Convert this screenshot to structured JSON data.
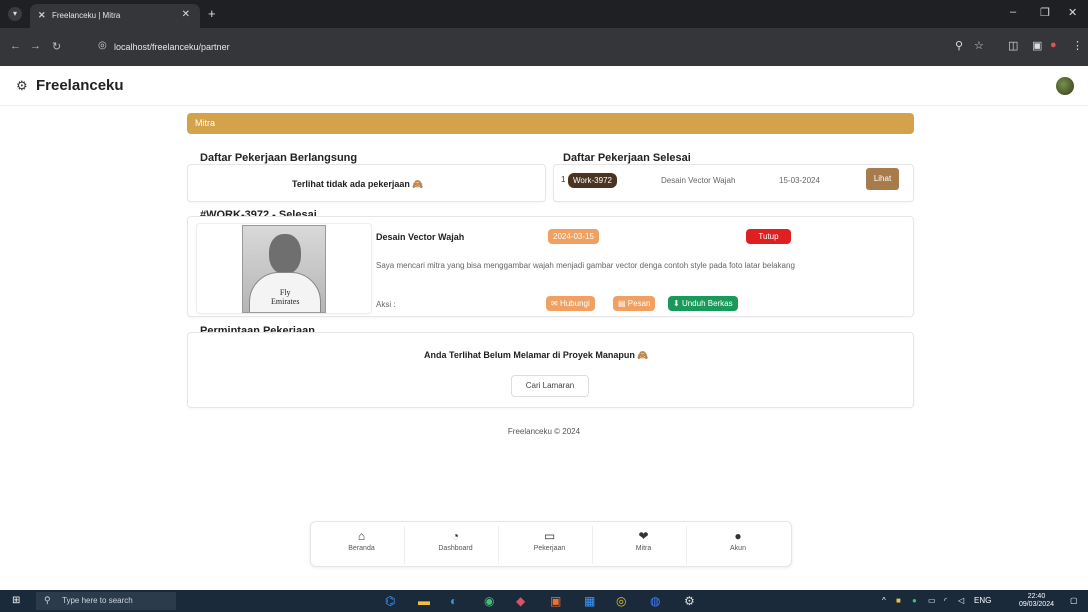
{
  "browser": {
    "tab_title": "Freelanceku | Mitra",
    "url": "localhost/freelanceku/partner"
  },
  "app": {
    "brand": "Freelanceku"
  },
  "page": {
    "section_label": "Mitra",
    "ongoing_title": "Daftar Pekerjaan Berlangsung",
    "ongoing_empty": "Terlihat tidak ada pekerjaan 🙈",
    "finished_title": "Daftar Pekerjaan Selesai",
    "finished_rows": [
      {
        "no": "1",
        "code": "Work-3972",
        "name": "Desain Vector Wajah",
        "date": "15-03-2024",
        "action": "Lihat"
      }
    ],
    "detail": {
      "heading": "#WORK-3972 - Selesai",
      "title": "Desain Vector Wajah",
      "date_badge": "2024-03-15",
      "status_badge": "Tutup",
      "description": "Saya mencari mitra yang bisa menggambar wajah menjadi gambar vector denga contoh style pada foto latar belakang",
      "action_label": "Aksi :",
      "actions": {
        "contact": "Hubungi",
        "message": "Pesan",
        "download": "Unduh Berkas"
      },
      "photo_logo": "Fly\nEmirates"
    },
    "requests_title": "Permintaan Pekerjaan",
    "requests_empty": "Anda Terlihat Belum Melamar di Proyek Manapun 🙈",
    "find_button": "Cari Lamaran",
    "footer": "Freelanceku © 2024"
  },
  "bottom_nav": [
    {
      "label": "Beranda",
      "icon": "home-icon"
    },
    {
      "label": "Dashboard",
      "icon": "dashboard-icon"
    },
    {
      "label": "Pekerjaan",
      "icon": "briefcase-icon"
    },
    {
      "label": "Mitra",
      "icon": "handshake-icon"
    },
    {
      "label": "Akun",
      "icon": "user-icon"
    }
  ],
  "taskbar": {
    "search_placeholder": "Type here to search",
    "lang": "ENG",
    "time": "22:40",
    "date": "09/03/2024"
  },
  "colors": {
    "accent": "#d4a24a",
    "brown": "#a87b4d",
    "orange": "#f0a060",
    "red": "#e02020",
    "green": "#1a9a5a"
  }
}
